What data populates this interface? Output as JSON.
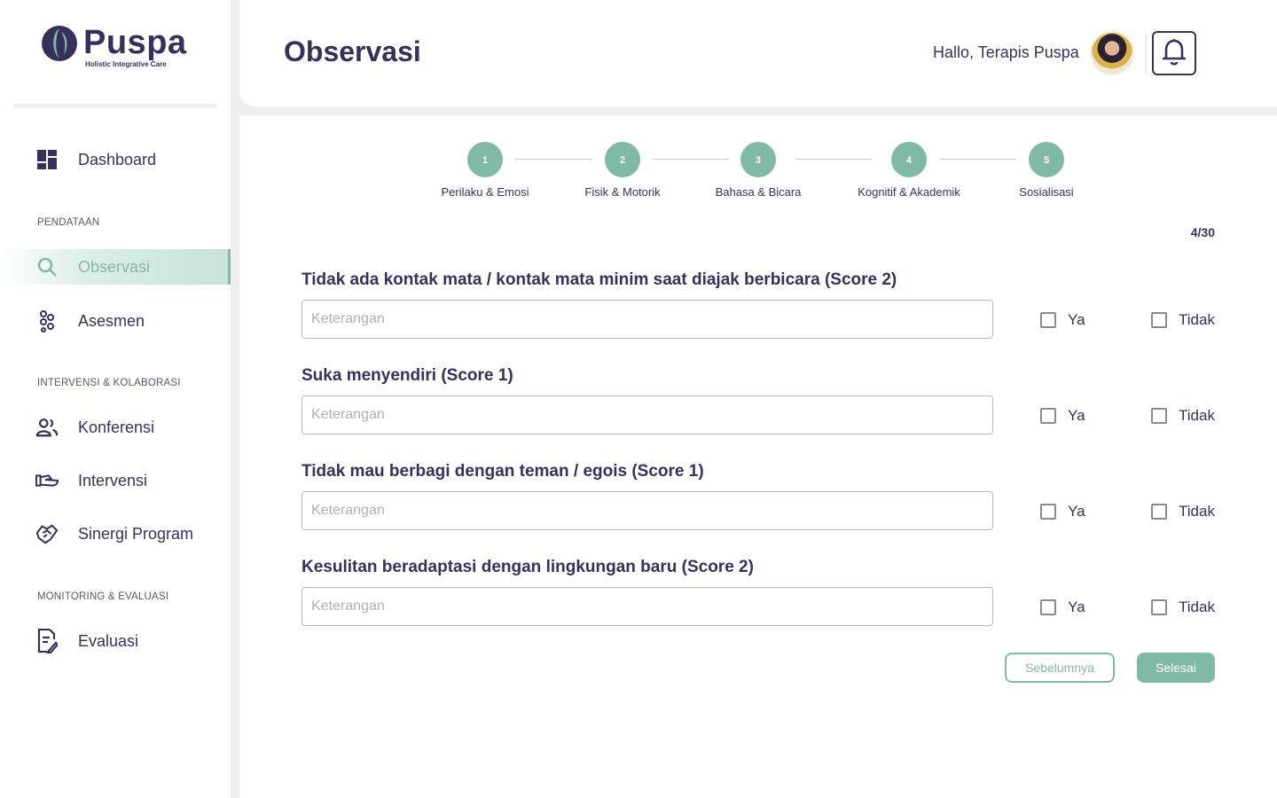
{
  "brand": {
    "name": "Puspa",
    "tagline": "Holistic Integrative Care",
    "accent_color": "#81b9a7",
    "text_color": "#36315b"
  },
  "sidebar": {
    "items": [
      {
        "label": "Dashboard",
        "icon": "dashboard-icon"
      },
      {
        "label": "Observasi",
        "icon": "search-icon",
        "active": true
      },
      {
        "label": "Asesmen",
        "icon": "asesmen-icon"
      },
      {
        "label": "Konferensi",
        "icon": "people-icon"
      },
      {
        "label": "Intervensi",
        "icon": "hand-icon"
      },
      {
        "label": "Sinergi Program",
        "icon": "handshake-icon"
      },
      {
        "label": "Evaluasi",
        "icon": "document-edit-icon"
      }
    ],
    "sections": [
      "PENDATAAN",
      "INTERVENSI & KOLABORASI",
      "MONITORING & EVALUASI"
    ]
  },
  "header": {
    "title": "Observasi",
    "greeting": "Hallo, Terapis Puspa",
    "notification_icon": "bell-icon"
  },
  "stepper": {
    "steps": [
      {
        "number": "1",
        "label": "Perilaku & Emosi"
      },
      {
        "number": "2",
        "label": "Fisik & Motorik"
      },
      {
        "number": "3",
        "label": "Bahasa & Bicara"
      },
      {
        "number": "4",
        "label": "Kognitif & Akademik"
      },
      {
        "number": "5",
        "label": "Sosialisasi"
      }
    ]
  },
  "progress": "4/30",
  "questions": [
    {
      "title": "Tidak ada kontak mata / kontak mata minim saat diajak berbicara (Score 2)",
      "placeholder": "Keterangan",
      "yes": "Ya",
      "no": "Tidak"
    },
    {
      "title": "Suka menyendiri (Score 1)",
      "placeholder": "Keterangan",
      "yes": "Ya",
      "no": "Tidak"
    },
    {
      "title": "Tidak mau berbagi dengan teman / egois (Score 1)",
      "placeholder": "Keterangan",
      "yes": "Ya",
      "no": "Tidak"
    },
    {
      "title": "Kesulitan beradaptasi dengan lingkungan baru (Score 2)",
      "placeholder": "Keterangan",
      "yes": "Ya",
      "no": "Tidak"
    }
  ],
  "actions": {
    "previous": "Sebelumnya",
    "finish": "Selesai"
  }
}
